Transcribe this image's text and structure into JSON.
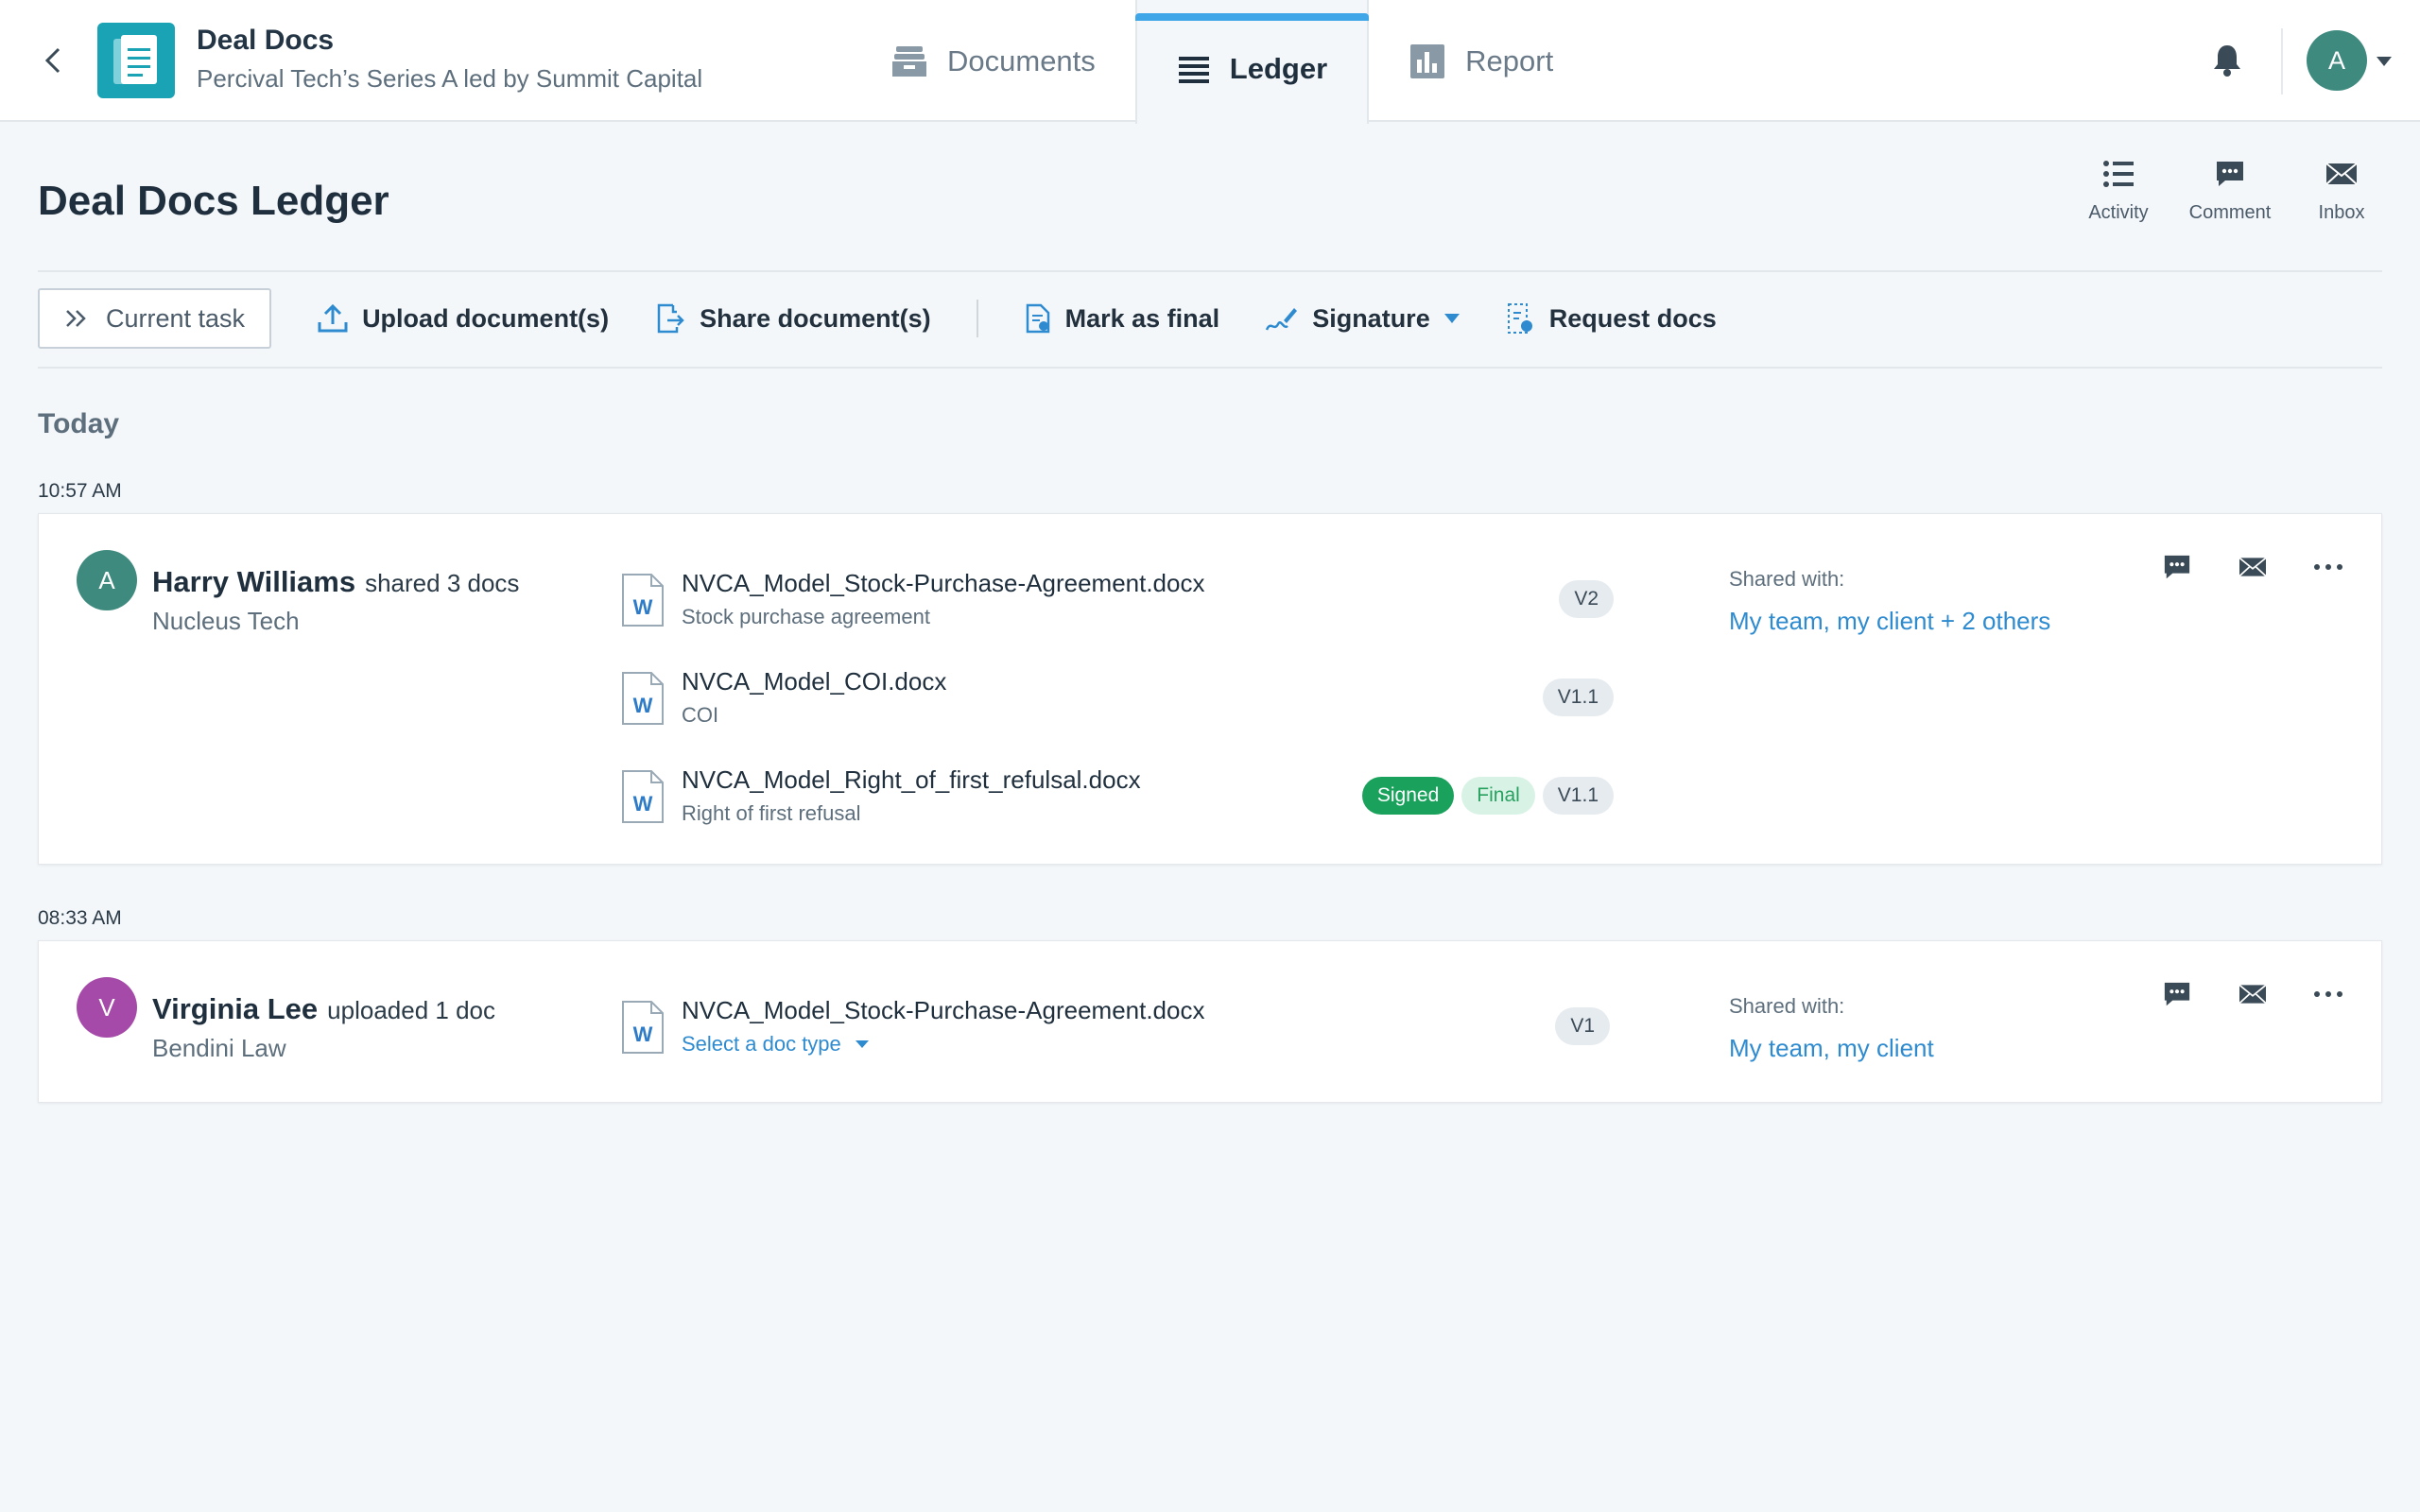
{
  "header": {
    "app_title": "Deal Docs",
    "app_subtitle": "Percival Tech’s Series A led by Summit Capital",
    "tabs": [
      {
        "label": "Documents",
        "icon": "inbox-tray-icon"
      },
      {
        "label": "Ledger",
        "icon": "list-lines-icon",
        "active": true
      },
      {
        "label": "Report",
        "icon": "bar-chart-icon"
      }
    ],
    "user_initial": "A"
  },
  "page": {
    "title": "Deal Docs Ledger",
    "tools": [
      {
        "label": "Activity",
        "icon": "activity-list-icon"
      },
      {
        "label": "Comment",
        "icon": "comment-icon"
      },
      {
        "label": "Inbox",
        "icon": "envelope-icon"
      }
    ]
  },
  "toolbar": {
    "current_task": "Current task",
    "upload": "Upload document(s)",
    "share": "Share document(s)",
    "mark_final": "Mark as final",
    "signature": "Signature",
    "request": "Request docs"
  },
  "ledger": {
    "group_label": "Today",
    "entries": [
      {
        "time": "10:57 AM",
        "initial": "A",
        "avatar_color": "#3f8a7f",
        "name": "Harry Williams",
        "action": "shared 3 docs",
        "org": "Nucleus Tech",
        "shared_label": "Shared with:",
        "shared_with": "My team, my client + 2 others",
        "docs": [
          {
            "name": "NVCA_Model_Stock-Purchase-Agreement.docx",
            "type": "Stock purchase agreement",
            "version": "V2"
          },
          {
            "name": "NVCA_Model_COI.docx",
            "type": "COI",
            "version": "V1.1"
          },
          {
            "name": "NVCA_Model_Right_of_first_refulsal.docx",
            "type": "Right of first refusal",
            "version": "V1.1",
            "signed": "Signed",
            "final": "Final"
          }
        ]
      },
      {
        "time": "08:33 AM",
        "initial": "V",
        "avatar_color": "#a54aa8",
        "name": "Virginia Lee",
        "action": "uploaded 1 doc",
        "org": "Bendini Law",
        "shared_label": "Shared with:",
        "shared_with": "My team, my client",
        "docs": [
          {
            "name": "NVCA_Model_Stock-Purchase-Agreement.docx",
            "type": "Select a doc type",
            "version": "V1"
          }
        ]
      }
    ]
  },
  "colors": {
    "accent": "#3fa6e8",
    "link": "#2e8bd0",
    "signed": "#1aa25d",
    "logo": "#1aa3b5"
  }
}
